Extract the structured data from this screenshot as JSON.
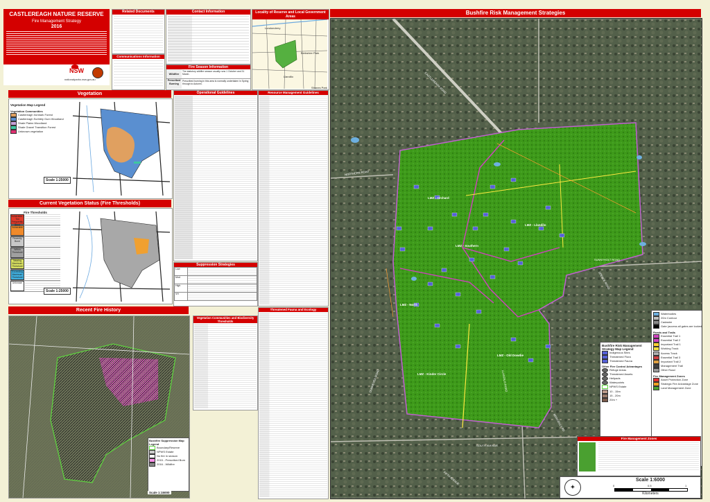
{
  "header": {
    "reserve": "CASTLEREAGH NATURE RESERVE",
    "subtitle": "Fire Management Strategy",
    "year": "2016",
    "agency_logo_text": "NSW",
    "agency_name": "nationalparks.nsw.gov.au"
  },
  "panels": {
    "related_documents": "Related Documents",
    "contact_information": "Contact Information",
    "locality": "Locality of Reserve and Local Government Areas",
    "communications": "Communications Information",
    "fire_season": "Fire Season Information",
    "vegetation": "Vegetation",
    "current_veg_status": "Current Vegetation Status (Fire Thresholds)",
    "recent_fire_history": "Recent Fire History",
    "operational_guidelines": "Operational Guidelines",
    "suppression_strategies": "Suppression Strategies",
    "resource_guidelines": "Resource Management Guidelines",
    "veg_communities_thresholds": "Vegetation Communities and Biodiversity Thresholds",
    "threatened_fauna": "Threatened Fauna and Ecology",
    "main_map": "Bushfire Risk Management Strategies"
  },
  "veg_legend": {
    "title": "Vegetation Map Legend",
    "subtitle": "Vegetation Communities",
    "items": [
      {
        "label": "Castlereagh Ironbark Forest",
        "color": "#e0a060"
      },
      {
        "label": "Castlereagh Scribbly Gum Woodland",
        "color": "#5a8fd0"
      },
      {
        "label": "Shale Plains Woodland",
        "color": "#c8a0d8"
      },
      {
        "label": "Shale Gravel Transition Forest",
        "color": "#3ec7a0"
      },
      {
        "label": "Unknown vegetation",
        "color": "#e03070"
      }
    ],
    "scale": "Scale 1:25000"
  },
  "fire_thresholds": {
    "title": "Fire Thresholds",
    "rows": [
      {
        "label": "Vulnerable / Too Frequently Burnt",
        "color": "#e03a2a"
      },
      {
        "label": "Vulnerable",
        "color": "#f08a2a"
      },
      {
        "label": "Recently Burnt",
        "color": "#c8c8c8"
      },
      {
        "label": "Within Threshold",
        "color": "#a0a0a0"
      },
      {
        "label": "Nearing Maximum Threshold",
        "color": "#d8e060"
      },
      {
        "label": "Exceeding Maximum Threshold",
        "color": "#40b0e0"
      },
      {
        "label": "Unknown",
        "color": "#ffffff"
      }
    ],
    "scale": "Scale 1:25000"
  },
  "fire_history_legend": {
    "title": "Bushfire Suppression Map Legend",
    "items": [
      "Boundary/Reserve",
      "NPWS Estate",
      "No fire in season",
      "2015 - Prescribed Burn",
      "2016 - Wildfire"
    ],
    "scale": "Scale 1:15000"
  },
  "fire_season": {
    "rows": [
      {
        "label": "Wildfire",
        "text": "The statutory wildfire season usually runs 1 October and 31 March."
      },
      {
        "label": "Prescribed Burning",
        "text": "Prescribed burning in this area is normally undertaken in Spring through to Autumn."
      }
    ]
  },
  "suppression_rows": [
    "Low",
    "Mod",
    "High",
    "VH"
  ],
  "road_labels": [
    "CASTLEREAGH ROAD",
    "NORTHERN ROAD",
    "SUNNYHOLT ROAD",
    "SPENCE ROAD",
    "LLANDILO ROAD",
    "ELIZABETH STREET",
    "DUNHEVED ROAD",
    "SOUTH AVENUE",
    "FIFTH AVENUE",
    "BRINGELLY RD",
    "TRIBE AVENUE",
    "FAULKLAND CRES"
  ],
  "zones": {
    "strategic": [
      "LMZ - Orchard",
      "LMZ - Llandilo",
      "LMZ - Southern",
      "LMZ - North",
      "LMZ - Kinder Circle",
      "LMZ - Old Dowdie"
    ],
    "main_legend_title": "Bushfire Risk Management Strategy Map Legend",
    "main_legend": [
      {
        "label": "Indigenous Sites",
        "color": "#5560d8"
      },
      {
        "label": "Threatened Flora",
        "color": "#5560d8"
      },
      {
        "label": "Threatened Fauna",
        "color": "#5560d8"
      }
    ],
    "other_legend_title": "Other Fire Control Advantages",
    "other_legend": [
      "Refuge Areas",
      "Threatened Assets",
      "Helipads",
      "Waterpoints"
    ],
    "estate_label": "NPWS Estate",
    "contours": [
      "10 - 15m",
      "15 - 20m",
      "20m +"
    ],
    "right_legend": [
      {
        "label": "Waterbodies",
        "color": "#6db0e0"
      },
      {
        "label": "20m Contour",
        "color": "#c0c0c0"
      },
      {
        "label": "Cadastre",
        "color": "#888888"
      },
      {
        "label": "Gate (access all gates are locked)",
        "color": "#000000"
      }
    ],
    "roads_title": "Roads and Trails",
    "roads": [
      {
        "label": "Essential Trail 1",
        "color": "#d040c0"
      },
      {
        "label": "Essential Trail 2",
        "color": "#d040c0"
      },
      {
        "label": "Important Trail 1",
        "color": "#ffd030"
      },
      {
        "label": "Working Track",
        "color": "#f0e040"
      },
      {
        "label": "Access Track",
        "color": "#b0b0b0"
      },
      {
        "label": "Essential Trail 3",
        "color": "#d04040"
      },
      {
        "label": "Important Trail 2",
        "color": "#e0a040"
      },
      {
        "label": "Management Trail",
        "color": "#404040"
      },
      {
        "label": "Other Road",
        "color": "#999999"
      }
    ],
    "fmz_title": "Fire Management Zones",
    "fmz": [
      {
        "label": "Asset Protection Zone",
        "color": "#e03030"
      },
      {
        "label": "Strategic Fire Advantage Zone",
        "color": "#f0a020"
      },
      {
        "label": "Land Management Zone",
        "color": "#4aa030"
      }
    ],
    "fmz_table_title": "Fire Management Zones",
    "scale": "Scale 1:6000",
    "scale_ticks": [
      "0",
      "0.5",
      "1"
    ],
    "scale_unit": "Kilometers"
  },
  "locality_labels": [
    "Londonderry",
    "Berkshire Park",
    "Llandilo",
    "Shanes Park"
  ]
}
